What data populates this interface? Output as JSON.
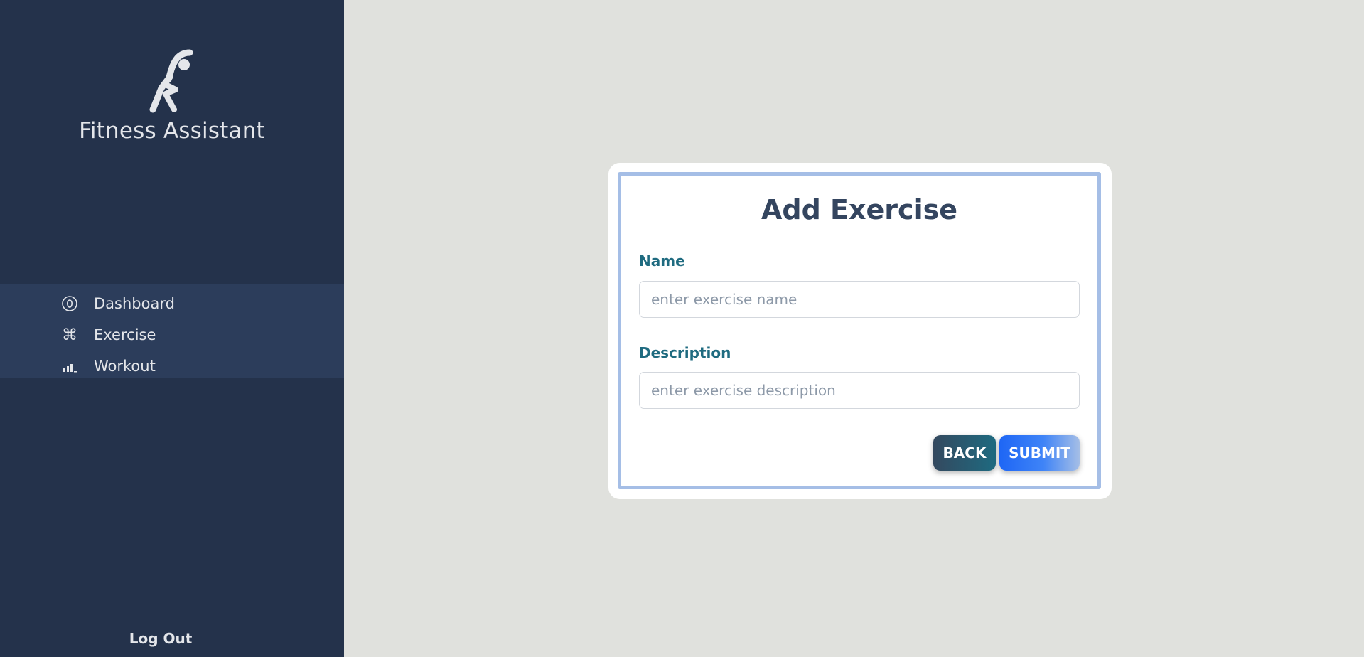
{
  "app": {
    "name": "Fitness Assistant",
    "logo_icon": "stretching-person-icon"
  },
  "sidebar": {
    "items": [
      {
        "label": "Dashboard",
        "icon": "circle-zero-icon"
      },
      {
        "label": "Exercise",
        "icon": "command-key-icon"
      },
      {
        "label": "Workout",
        "icon": "bar-chart-icon"
      }
    ],
    "logout_label": "Log Out"
  },
  "form": {
    "title": "Add Exercise",
    "name_label": "Name",
    "name_placeholder": "enter exercise name",
    "name_value": "",
    "description_label": "Description",
    "description_placeholder": "enter exercise description",
    "description_value": "",
    "back_label": "BACK",
    "submit_label": "SUBMIT"
  },
  "colors": {
    "sidebar_bg": "#24324b",
    "nav_bg": "#2c3d5b",
    "page_bg": "#e0e1dd",
    "card_border": "#a5bee6",
    "title_color": "#34455f",
    "label_color": "#1f6b80",
    "submit_accent": "#1e66f5"
  }
}
